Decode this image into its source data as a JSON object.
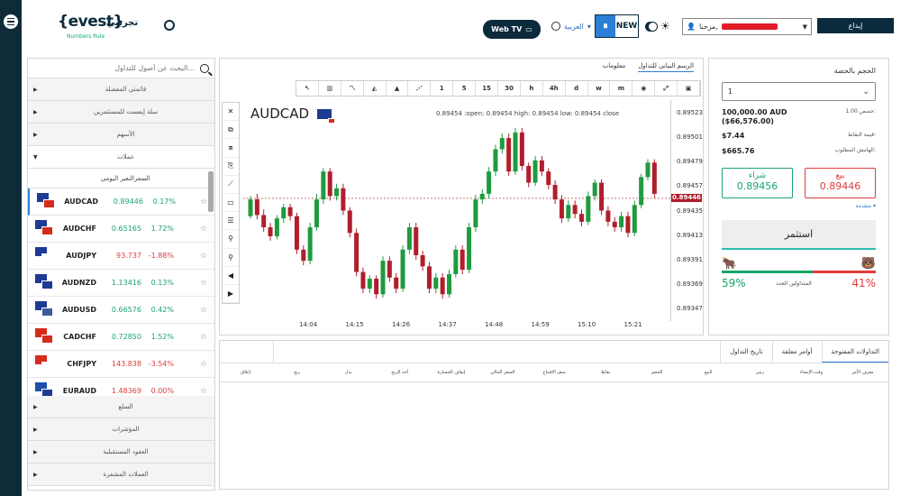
{
  "brand": {
    "logo_main": "{evest}",
    "logo_demo": "تجريبي",
    "logo_sub": "Numbers Rule"
  },
  "header": {
    "webtv": "Web TV",
    "language": "العربية",
    "new_label": "NEW",
    "user_greeting": "مرحبا,",
    "deposit": "إيداع"
  },
  "sidebar": {
    "search_placeholder": "البحث عن أصول للتداول...",
    "cats_top": [
      "قائمتي المفضلة",
      "سلة إيفست للمستثمرين",
      "الأسهم"
    ],
    "open_cat": "عملات",
    "col_change": "التغير اليومي",
    "col_price": "السعر",
    "instruments": [
      {
        "symbol": "AUDCAD",
        "price": "0.89446",
        "change": "0.17%",
        "dir": "up",
        "f1": "#1f3a93",
        "f2": "#d52b1e"
      },
      {
        "symbol": "AUDCHF",
        "price": "0.65165",
        "change": "1.72%",
        "dir": "up",
        "f1": "#1f3a93",
        "f2": "#d52b1e"
      },
      {
        "symbol": "AUDJPY",
        "price": "93.737",
        "change": "-1.88%",
        "dir": "dn",
        "f1": "#1f3a93",
        "f2": "#ffffff"
      },
      {
        "symbol": "AUDNZD",
        "price": "1.13416",
        "change": "0.13%",
        "dir": "up",
        "f1": "#1f3a93",
        "f2": "#1f3a93"
      },
      {
        "symbol": "AUDUSD",
        "price": "0.66576",
        "change": "0.42%",
        "dir": "up",
        "f1": "#1f3a93",
        "f2": "#3c5a9a"
      },
      {
        "symbol": "CADCHF",
        "price": "0.72850",
        "change": "1.52%",
        "dir": "up",
        "f1": "#d52b1e",
        "f2": "#d52b1e"
      },
      {
        "symbol": "CHFJPY",
        "price": "143.838",
        "change": "-3.54%",
        "dir": "dn",
        "f1": "#d52b1e",
        "f2": "#ffffff"
      },
      {
        "symbol": "EURAUD",
        "price": "1.48369",
        "change": "0.00%",
        "dir": "dn",
        "f1": "#1f4fa8",
        "f2": "#1f3a93"
      }
    ],
    "cats_bottom": [
      "السلع",
      "المؤشرات",
      "العقود المستقبلية",
      "العملات المشفرة"
    ]
  },
  "chart": {
    "tabs": [
      "الرسم البياني للتداول",
      "معلومات"
    ],
    "toolbar": [
      "↖",
      "▥",
      "〽",
      "◭",
      "▲",
      "⋰",
      "1",
      "5",
      "15",
      "30",
      "h",
      "4h",
      "d",
      "w",
      "m",
      "◉",
      "⤢",
      "▣"
    ],
    "left_tools": [
      "✕",
      "⧉",
      "⧈",
      "⎘",
      "⟋",
      "▭",
      "☰",
      "⚲",
      "⚲",
      "◀",
      "▶"
    ],
    "pair": "AUDCAD",
    "ohlc": "0.89454 :open: 0.89454 high: 0.89454 low: 0.89454 close",
    "current_price": "0.89446",
    "y_ticks": [
      "0.89523",
      "0.89501",
      "0.89479",
      "0.89457",
      "0.89435",
      "0.89413",
      "0.89391",
      "0.89369",
      "0.89347"
    ],
    "x_ticks": [
      "14:04",
      "14:15",
      "14:26",
      "14:37",
      "14:48",
      "14:59",
      "15:10",
      "15:21"
    ],
    "ylim": [
      0.89336,
      0.89534
    ],
    "candles": [
      [
        0.8943,
        0.89445,
        0.89428,
        0.89448
      ],
      [
        0.89445,
        0.89431,
        0.89427,
        0.8945
      ],
      [
        0.89431,
        0.8942,
        0.89416,
        0.89436
      ],
      [
        0.8942,
        0.89412,
        0.89408,
        0.89424
      ],
      [
        0.89412,
        0.89428,
        0.89409,
        0.89431
      ],
      [
        0.89428,
        0.89438,
        0.89424,
        0.89441
      ],
      [
        0.89438,
        0.8943,
        0.89426,
        0.89441
      ],
      [
        0.8943,
        0.894,
        0.89396,
        0.89433
      ],
      [
        0.894,
        0.8939,
        0.89386,
        0.89404
      ],
      [
        0.8939,
        0.8942,
        0.89387,
        0.89424
      ],
      [
        0.8942,
        0.89445,
        0.89417,
        0.8945
      ],
      [
        0.89445,
        0.8947,
        0.89441,
        0.89473
      ],
      [
        0.8947,
        0.89448,
        0.89444,
        0.89473
      ],
      [
        0.89448,
        0.89455,
        0.89444,
        0.89459
      ],
      [
        0.89455,
        0.89435,
        0.89431,
        0.89459
      ],
      [
        0.89435,
        0.89415,
        0.89411,
        0.89438
      ],
      [
        0.89415,
        0.8938,
        0.89376,
        0.89419
      ],
      [
        0.8938,
        0.89365,
        0.89361,
        0.89384
      ],
      [
        0.89365,
        0.89374,
        0.89361,
        0.89377
      ],
      [
        0.89374,
        0.8936,
        0.89356,
        0.89377
      ],
      [
        0.8936,
        0.8939,
        0.89357,
        0.89394
      ],
      [
        0.8939,
        0.89375,
        0.89371,
        0.89394
      ],
      [
        0.89375,
        0.89365,
        0.89361,
        0.89379
      ],
      [
        0.89365,
        0.894,
        0.89362,
        0.89404
      ],
      [
        0.894,
        0.8942,
        0.89396,
        0.89424
      ],
      [
        0.8942,
        0.89395,
        0.89391,
        0.89424
      ],
      [
        0.89395,
        0.89385,
        0.89381,
        0.89399
      ],
      [
        0.89385,
        0.89365,
        0.89361,
        0.89389
      ],
      [
        0.89365,
        0.89375,
        0.89361,
        0.89379
      ],
      [
        0.89375,
        0.8936,
        0.89356,
        0.89379
      ],
      [
        0.8936,
        0.89378,
        0.89357,
        0.89382
      ],
      [
        0.89378,
        0.894,
        0.89375,
        0.89404
      ],
      [
        0.894,
        0.89382,
        0.89378,
        0.89404
      ],
      [
        0.89382,
        0.8942,
        0.89379,
        0.89424
      ],
      [
        0.8942,
        0.89445,
        0.89416,
        0.89449
      ],
      [
        0.89445,
        0.8945,
        0.89441,
        0.89454
      ],
      [
        0.8945,
        0.8947,
        0.89446,
        0.89474
      ],
      [
        0.8947,
        0.8949,
        0.89466,
        0.89494
      ],
      [
        0.8949,
        0.895,
        0.89486,
        0.89504
      ],
      [
        0.895,
        0.8947,
        0.89466,
        0.89504
      ],
      [
        0.8947,
        0.89505,
        0.89467,
        0.89509
      ],
      [
        0.89505,
        0.89475,
        0.89471,
        0.89509
      ],
      [
        0.89475,
        0.8946,
        0.89456,
        0.89478
      ],
      [
        0.8946,
        0.8948,
        0.89457,
        0.89484
      ],
      [
        0.8948,
        0.8947,
        0.89466,
        0.89484
      ],
      [
        0.8947,
        0.89458,
        0.89454,
        0.89473
      ],
      [
        0.89458,
        0.89445,
        0.89441,
        0.89462
      ],
      [
        0.89445,
        0.89428,
        0.89424,
        0.89449
      ],
      [
        0.89428,
        0.8944,
        0.89425,
        0.89444
      ],
      [
        0.8944,
        0.89432,
        0.89428,
        0.89444
      ],
      [
        0.89432,
        0.89425,
        0.89421,
        0.89436
      ],
      [
        0.89425,
        0.89448,
        0.89422,
        0.89452
      ],
      [
        0.89448,
        0.8946,
        0.89444,
        0.89463
      ],
      [
        0.8946,
        0.89435,
        0.89431,
        0.89463
      ],
      [
        0.89435,
        0.89425,
        0.89421,
        0.89439
      ],
      [
        0.89425,
        0.8942,
        0.89416,
        0.89429
      ],
      [
        0.8942,
        0.8943,
        0.89416,
        0.89434
      ],
      [
        0.8943,
        0.89415,
        0.89411,
        0.89434
      ],
      [
        0.89415,
        0.8944,
        0.89412,
        0.89444
      ],
      [
        0.8944,
        0.89465,
        0.89437,
        0.89468
      ],
      [
        0.89465,
        0.89478,
        0.89462,
        0.89481
      ],
      [
        0.89478,
        0.8945,
        0.89446,
        0.89481
      ]
    ]
  },
  "trade": {
    "amount_label": "الحجم بالحصة",
    "amount_value": "1",
    "lot_value": "100,000.00 AUD",
    "lot_usd": "($66,576.00)",
    "lot_key": "1.00 حصص:",
    "trade_value": "$7.44",
    "trade_value_key": "قيمة النقاط:",
    "margin": "$665.76",
    "margin_key": "الهامش المطلوب:",
    "buy_label": "شراء",
    "buy_price": "0.89456",
    "sell_label": "بيع",
    "sell_price": "0.89446",
    "advanced": "متقدمة",
    "invest": "استثمر",
    "buy_pct": "59%",
    "sell_pct": "41%",
    "sentiment_label": "المتداولين الجدد",
    "buy_frac": 0.59
  },
  "positions": {
    "tabs": [
      "التداولات المفتوحة",
      "أوامر معلقة",
      "تاريخ التداول"
    ],
    "headers": [
      "إغلاق",
      "ربح",
      "بدل",
      "أخذ الربح",
      "إيقاف الخسارة",
      "السعر الحالي",
      "سعر الافتتاح",
      "نقاط",
      "الحجم",
      "البيع",
      "زمن",
      "وقت الإنشاء",
      "معرف الأمر"
    ]
  }
}
